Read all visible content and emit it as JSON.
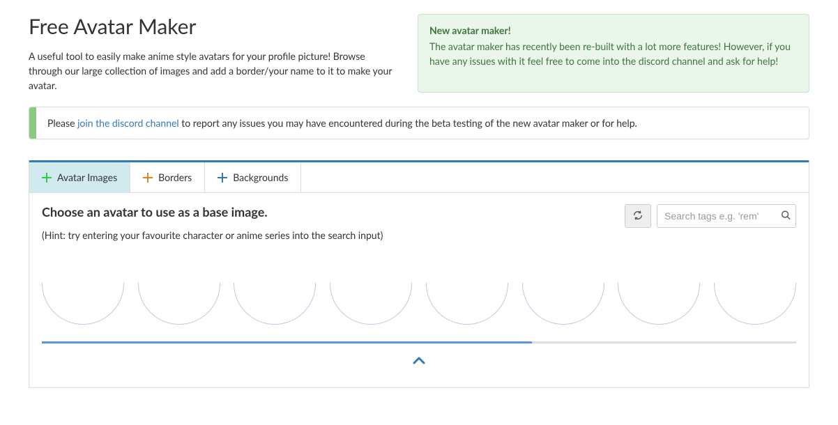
{
  "header": {
    "title": "Free Avatar Maker",
    "subtitle": "A useful tool to easily make anime style avatars for your profile picture! Browse through our large collection of images and add a border/your name to it to make your avatar."
  },
  "alert": {
    "title": "New avatar maker!",
    "text": "The avatar maker has recently been re-built with a lot more features! However, if you have any issues with it feel free to come into the discord channel and ask for help!"
  },
  "discord_banner": {
    "prefix": "Please ",
    "link_text": "join the discord channel",
    "suffix": " to report any issues you may have encountered during the beta testing of the new avatar maker or for help."
  },
  "tabs": [
    {
      "label": "Avatar Images",
      "icon": "plus-icon",
      "icon_color": "#2ecc40",
      "active": true
    },
    {
      "label": "Borders",
      "icon": "plus-icon",
      "icon_color": "#e67e22",
      "active": false
    },
    {
      "label": "Backgrounds",
      "icon": "plus-icon",
      "icon_color": "#337ab7",
      "active": false
    }
  ],
  "section": {
    "heading": "Choose an avatar to use as a base image.",
    "hint": "(Hint: try entering your favourite character or anime series into the search input)"
  },
  "search": {
    "placeholder": "Search tags e.g. 'rem'"
  },
  "avatar_slots": 8,
  "progress_percent": 65
}
